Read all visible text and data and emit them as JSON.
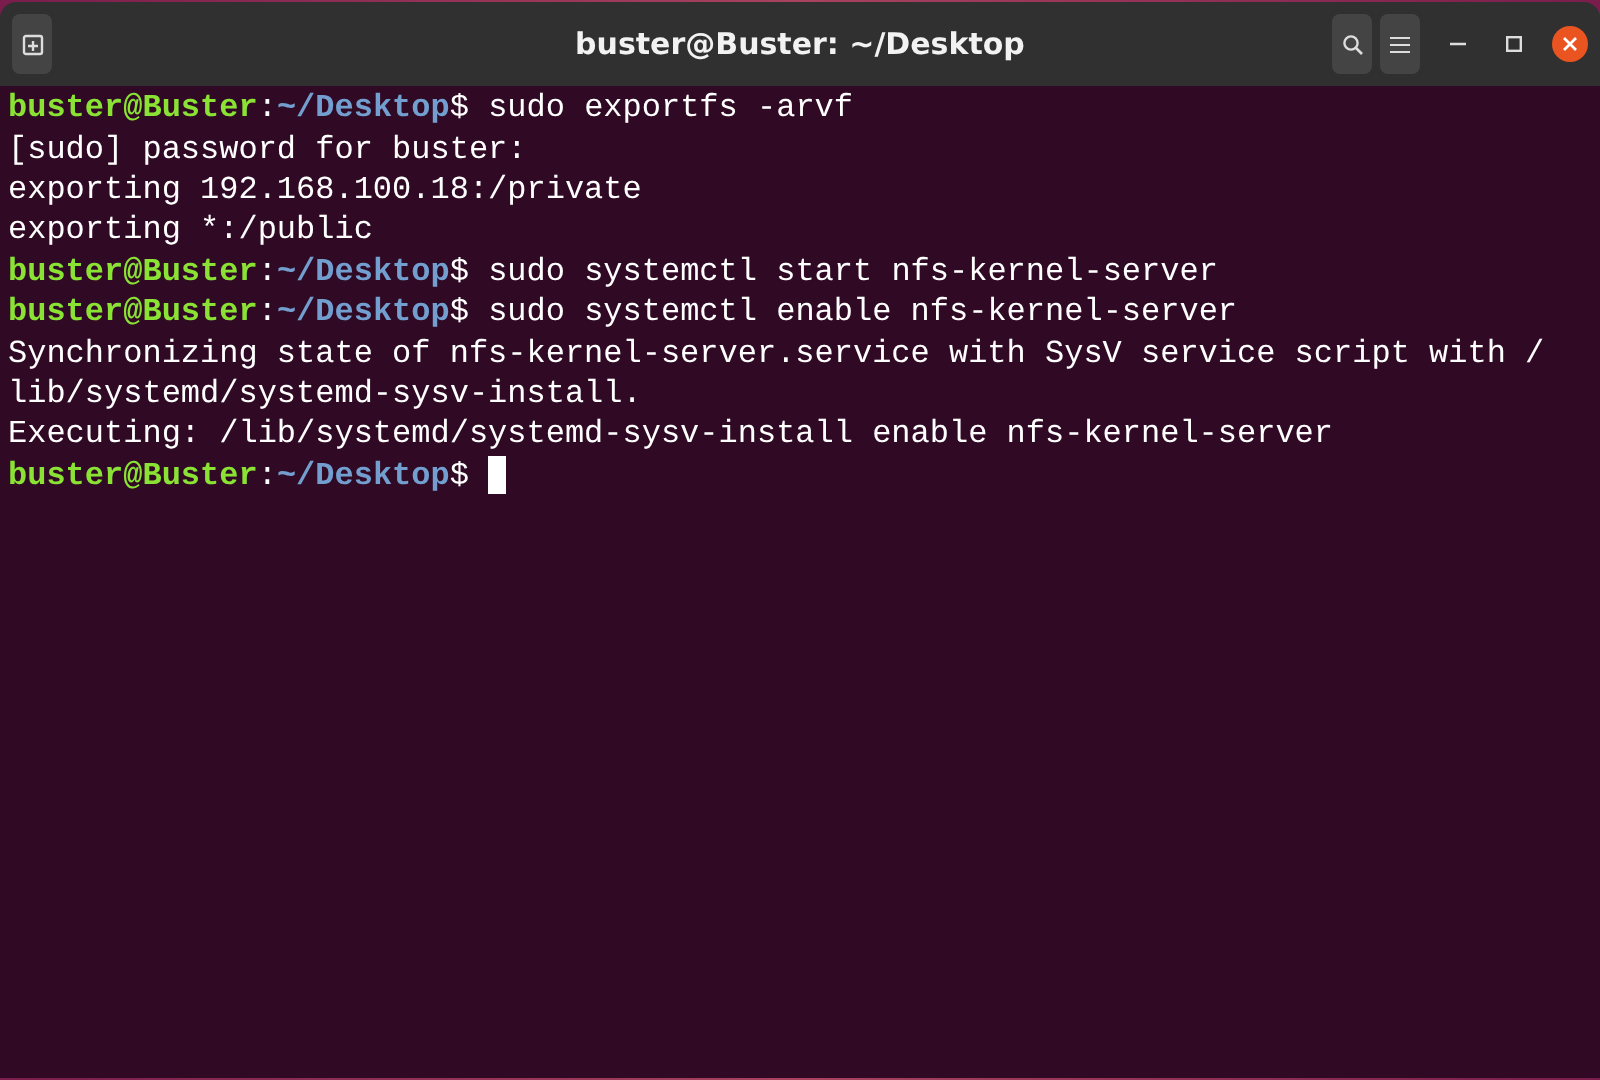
{
  "window": {
    "title": "buster@Buster: ~/Desktop"
  },
  "lines": [
    {
      "kind": "prompt",
      "user": "buster@Buster",
      "separator": ":",
      "path": "~/Desktop",
      "symbol": "$",
      "command": "sudo exportfs -arvf"
    },
    {
      "kind": "output",
      "text": "[sudo] password for buster:"
    },
    {
      "kind": "output",
      "text": "exporting 192.168.100.18:/private"
    },
    {
      "kind": "output",
      "text": "exporting *:/public"
    },
    {
      "kind": "prompt",
      "user": "buster@Buster",
      "separator": ":",
      "path": "~/Desktop",
      "symbol": "$",
      "command": "sudo systemctl start nfs-kernel-server"
    },
    {
      "kind": "prompt",
      "user": "buster@Buster",
      "separator": ":",
      "path": "~/Desktop",
      "symbol": "$",
      "command": "sudo systemctl enable nfs-kernel-server"
    },
    {
      "kind": "output",
      "text": "Synchronizing state of nfs-kernel-server.service with SysV service script with /"
    },
    {
      "kind": "output",
      "text": "lib/systemd/systemd-sysv-install."
    },
    {
      "kind": "output",
      "text": "Executing: /lib/systemd/systemd-sysv-install enable nfs-kernel-server"
    },
    {
      "kind": "prompt",
      "user": "buster@Buster",
      "separator": ":",
      "path": "~/Desktop",
      "symbol": "$",
      "cursor": true
    }
  ]
}
